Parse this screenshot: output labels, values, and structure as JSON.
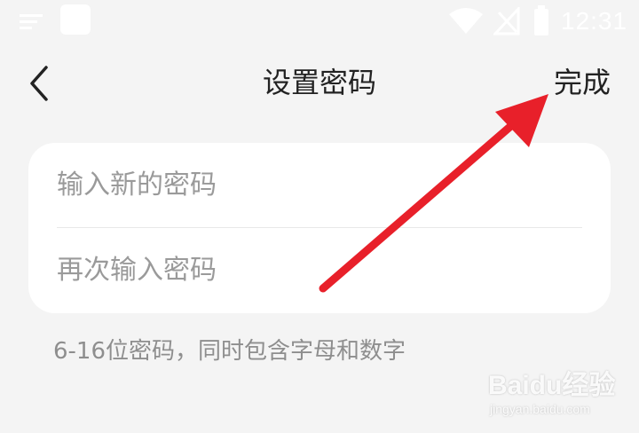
{
  "status_bar": {
    "time": "12:31",
    "icons": [
      "menu-icon",
      "app-icon",
      "wifi-icon",
      "signal-icon",
      "battery-icon"
    ]
  },
  "nav": {
    "back_icon": "chevron-left-icon",
    "title": "设置密码",
    "done_label": "完成"
  },
  "form": {
    "new_password_placeholder": "输入新的密码",
    "confirm_password_placeholder": "再次输入密码"
  },
  "hint": "6-16位密码，同时包含字母和数字",
  "annotation": {
    "color": "#e8202a"
  },
  "watermark": {
    "main": "Baidu经验",
    "sub": "jingyan.baidu.com"
  }
}
